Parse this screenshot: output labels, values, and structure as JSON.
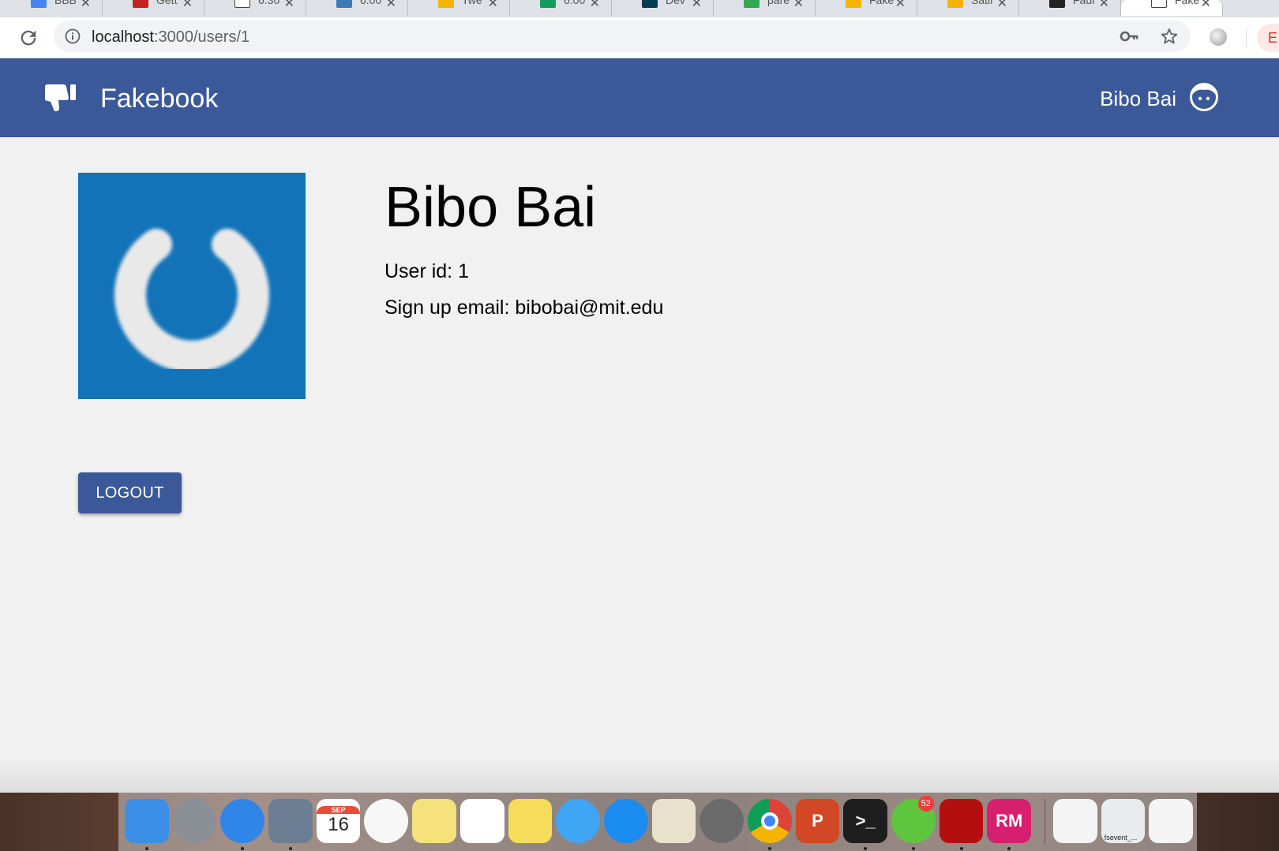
{
  "browser": {
    "tabs": [
      {
        "title": "BBB",
        "icon": "docs-icon",
        "color": "#4285f4"
      },
      {
        "title": "Gett",
        "icon": "gmail-icon",
        "color": "#c5221f"
      },
      {
        "title": "6.30",
        "icon": "page-icon",
        "color": "#ffffff"
      },
      {
        "title": "6.00",
        "icon": "piazza-icon",
        "color": "#3e7ab5"
      },
      {
        "title": "Twe",
        "icon": "twitter-icon",
        "color": "#f4b400"
      },
      {
        "title": "6.00",
        "icon": "sheets-icon",
        "color": "#0f9d58"
      },
      {
        "title": "Dev",
        "icon": "devpost-icon",
        "color": "#003e54"
      },
      {
        "title": "pare",
        "icon": "google-icon",
        "color": "#34a853"
      },
      {
        "title": "Fake",
        "icon": "slides-icon",
        "color": "#f4b400"
      },
      {
        "title": "Satir",
        "icon": "slides-icon",
        "color": "#f4b400"
      },
      {
        "title": "Faul",
        "icon": "github-icon",
        "color": "#222222"
      },
      {
        "title": "Fake",
        "icon": "page-icon",
        "color": "#ffffff"
      }
    ],
    "tab_close_glyph": "✕",
    "url_host": "localhost",
    "url_path": ":3000/users/1",
    "profile_initial": "E"
  },
  "navbar": {
    "brand_name": "Fakebook",
    "brand_icon": "thumbs-down-icon",
    "user_name": "Bibo Bai",
    "user_icon": "avatar-face-icon",
    "color": "#3b5998"
  },
  "profile": {
    "name": "Bibo Bai",
    "user_id_line": "User id: 1",
    "email_line": "Sign up email: bibobai@mit.edu",
    "photo_icon": "power-icon",
    "photo_bg": "#1273b8"
  },
  "actions": {
    "logout_label": "LOGOUT"
  },
  "dock": {
    "items": [
      {
        "name": "finder-icon",
        "running": true,
        "bg": "#3b8fe6"
      },
      {
        "name": "launchpad-icon",
        "running": false,
        "bg": "#8a8f96"
      },
      {
        "name": "safari-icon",
        "running": true,
        "bg": "#2f86e8"
      },
      {
        "name": "preview-icon",
        "running": true,
        "bg": "#6b7e93"
      },
      {
        "name": "calendar-icon",
        "running": false,
        "bg": "#ffffff",
        "month": "SEP",
        "day": "16"
      },
      {
        "name": "photos-icon",
        "running": false,
        "bg": "#f7f7f7"
      },
      {
        "name": "stickies-icon",
        "running": false,
        "bg": "#f5e27a"
      },
      {
        "name": "reminders-icon",
        "running": false,
        "bg": "#ffffff"
      },
      {
        "name": "notes-icon",
        "running": false,
        "bg": "#f7dc5b"
      },
      {
        "name": "messages-icon",
        "running": false,
        "bg": "#3ea6f5"
      },
      {
        "name": "app-store-icon",
        "running": false,
        "bg": "#1a8cf0"
      },
      {
        "name": "textedit-icon",
        "running": false,
        "bg": "#e8e1cc"
      },
      {
        "name": "system-preferences-icon",
        "running": false,
        "bg": "#6b6b6b"
      },
      {
        "name": "chrome-icon",
        "running": true,
        "bg": "#ffffff"
      },
      {
        "name": "powerpoint-icon",
        "running": false,
        "bg": "#d24726",
        "glyph": "P"
      },
      {
        "name": "terminal-icon",
        "running": true,
        "bg": "#1e1e1e",
        "glyph": ">_"
      },
      {
        "name": "wechat-icon",
        "running": true,
        "bg": "#5ec53f",
        "badge": "52"
      },
      {
        "name": "acrobat-icon",
        "running": true,
        "bg": "#b40f0f"
      },
      {
        "name": "rubymine-icon",
        "running": true,
        "bg": "#d61f6e",
        "glyph": "RM"
      }
    ],
    "stack_items": [
      {
        "name": "document-stack-icon",
        "label": ""
      },
      {
        "name": "screenshot-stack-icon",
        "label": "fsevent_..."
      },
      {
        "name": "trash-icon",
        "label": ""
      }
    ]
  }
}
